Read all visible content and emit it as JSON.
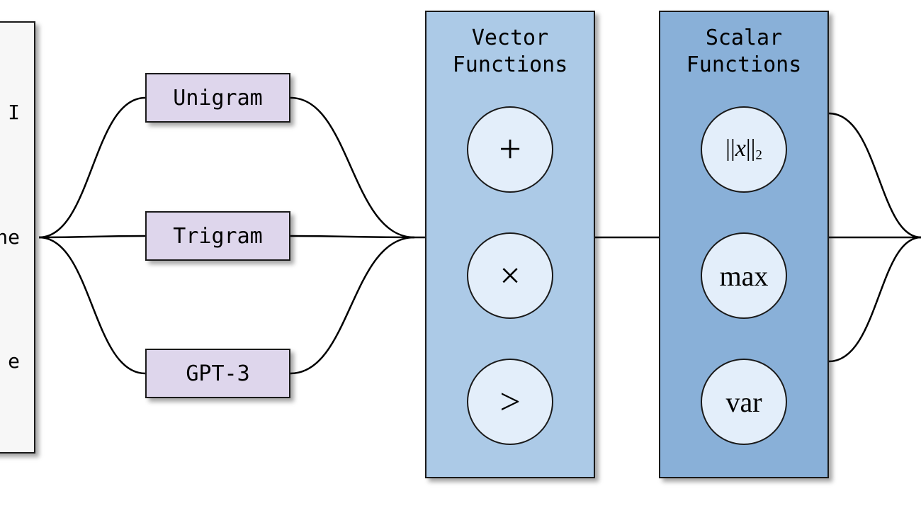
{
  "input_panel": {
    "line1": "I",
    "line2": "ne",
    "line3": "e"
  },
  "models": {
    "unigram": "Unigram",
    "trigram": "Trigram",
    "gpt3": "GPT-3"
  },
  "vector": {
    "title": "Vector\nFunctions",
    "ops": {
      "plus": "+",
      "times": "×",
      "gt": ">"
    }
  },
  "scalar": {
    "title": "Scalar\nFunctions",
    "ops": {
      "norm_html": "||<span class='ital'>x</span>||<span class='sub'>2</span>",
      "max": "max",
      "var": "var"
    }
  },
  "colors": {
    "model_fill": "#ded6ec",
    "vector_fill": "#accae7",
    "scalar_fill": "#89b0d8",
    "circle_fill": "#e3eefa",
    "border": "#1a1a1a"
  }
}
